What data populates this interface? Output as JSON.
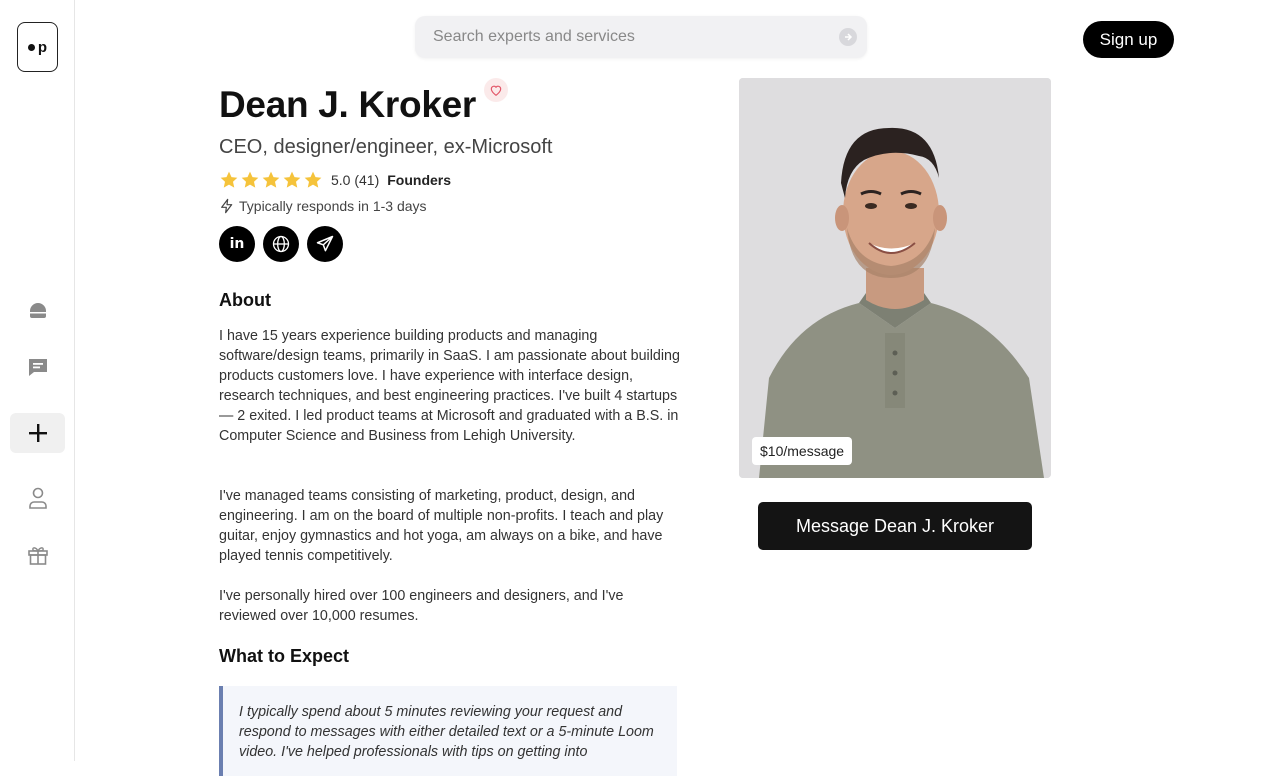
{
  "sidebar": {
    "logo_text": "p",
    "items": [
      {
        "icon": "home-icon"
      },
      {
        "icon": "chat-icon"
      },
      {
        "icon": "plus-icon",
        "active": true
      },
      {
        "icon": "user-icon"
      },
      {
        "icon": "gift-icon"
      }
    ]
  },
  "header": {
    "search_placeholder": "Search experts and services",
    "signup_label": "Sign up"
  },
  "profile": {
    "name": "Dean J. Kroker",
    "headline": "CEO, designer/engineer, ex-Microsoft",
    "rating": "5.0 (41)",
    "stars": 5,
    "category": "Founders",
    "responds": "Typically responds in 1-3 days",
    "socials": [
      "linkedin-icon",
      "globe-icon",
      "send-icon"
    ]
  },
  "about": {
    "title": "About",
    "paragraphs": [
      "I have 15 years experience building products and managing software/design teams, primarily in SaaS. I am passionate about building products customers love. I have experience with interface design, research techniques, and best engineering practices. I've built 4 startups — 2 exited. I led product teams at Microsoft and graduated with a B.S. in Computer Science and Business from Lehigh University.",
      "I've managed teams consisting of marketing, product, design, and engineering. I am on the board of multiple non-profits. I teach and play guitar, enjoy gymnastics and hot yoga, am always on a bike, and have played tennis competitively.",
      "I've personally hired over 100 engineers and designers, and I've reviewed over 10,000 resumes."
    ]
  },
  "expect": {
    "title": "What to Expect",
    "quote": "I typically spend about 5 minutes reviewing your request and respond to messages with either detailed text or a 5-minute Loom video. I've helped professionals with tips on getting into"
  },
  "card": {
    "price": "$10/message",
    "message_button": "Message Dean J. Kroker"
  },
  "colors": {
    "accent": "#000000",
    "star": "#f5c33b",
    "quote_border": "#6b7fb0"
  }
}
